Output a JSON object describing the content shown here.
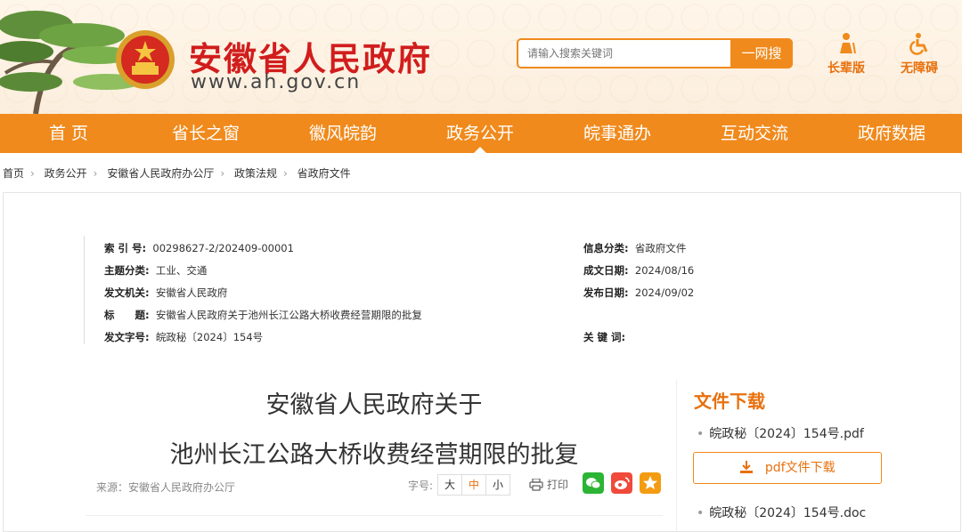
{
  "header": {
    "title": "安徽省人民政府",
    "domain": "www.ah.gov.cn",
    "search": {
      "placeholder": "请输入搜索关键词",
      "button": "一网搜"
    },
    "elder_mode": "长辈版",
    "accessibility": "无障碍"
  },
  "nav": {
    "items": [
      {
        "label": "首 页"
      },
      {
        "label": "省长之窗"
      },
      {
        "label": "徽风皖韵"
      },
      {
        "label": "政务公开"
      },
      {
        "label": "皖事通办"
      },
      {
        "label": "互动交流"
      },
      {
        "label": "政府数据"
      }
    ],
    "active_index": 3
  },
  "breadcrumb": [
    "首页",
    "政务公开",
    "安徽省人民政府办公厅",
    "政策法规",
    "省政府文件"
  ],
  "meta": {
    "index_label": "索 引 号:",
    "index_value": "00298627-2/202409-00001",
    "info_cat_label": "信息分类:",
    "info_cat_value": "省政府文件",
    "topic_label": "主题分类:",
    "topic_value": "工业、交通",
    "written_label": "成文日期:",
    "written_value": "2024/08/16",
    "issuer_label": "发文机关:",
    "issuer_value": "安徽省人民政府",
    "published_label": "发布日期:",
    "published_value": "2024/09/02",
    "title_label": "标　　题:",
    "title_value": "安徽省人民政府关于池州长江公路大桥收费经营期限的批复",
    "docno_label": "发文字号:",
    "docno_value": "皖政秘〔2024〕154号",
    "keywords_label": "关 键 词:",
    "keywords_value": ""
  },
  "article": {
    "title_line1": "安徽省人民政府关于",
    "title_line2": "池州长江公路大桥收费经营期限的批复",
    "source": "来源：安徽省人民政府办公厅",
    "font_label": "字号:",
    "font_sizes": [
      "大",
      "中",
      "小"
    ],
    "print": "打印"
  },
  "sidebar": {
    "heading": "文件下载",
    "files": [
      {
        "name": "皖政秘〔2024〕154号.pdf",
        "button": "pdf文件下载"
      },
      {
        "name": "皖政秘〔2024〕154号.doc"
      }
    ]
  },
  "colors": {
    "accent": "#f08a1c",
    "title_red": "#d11d1d"
  }
}
